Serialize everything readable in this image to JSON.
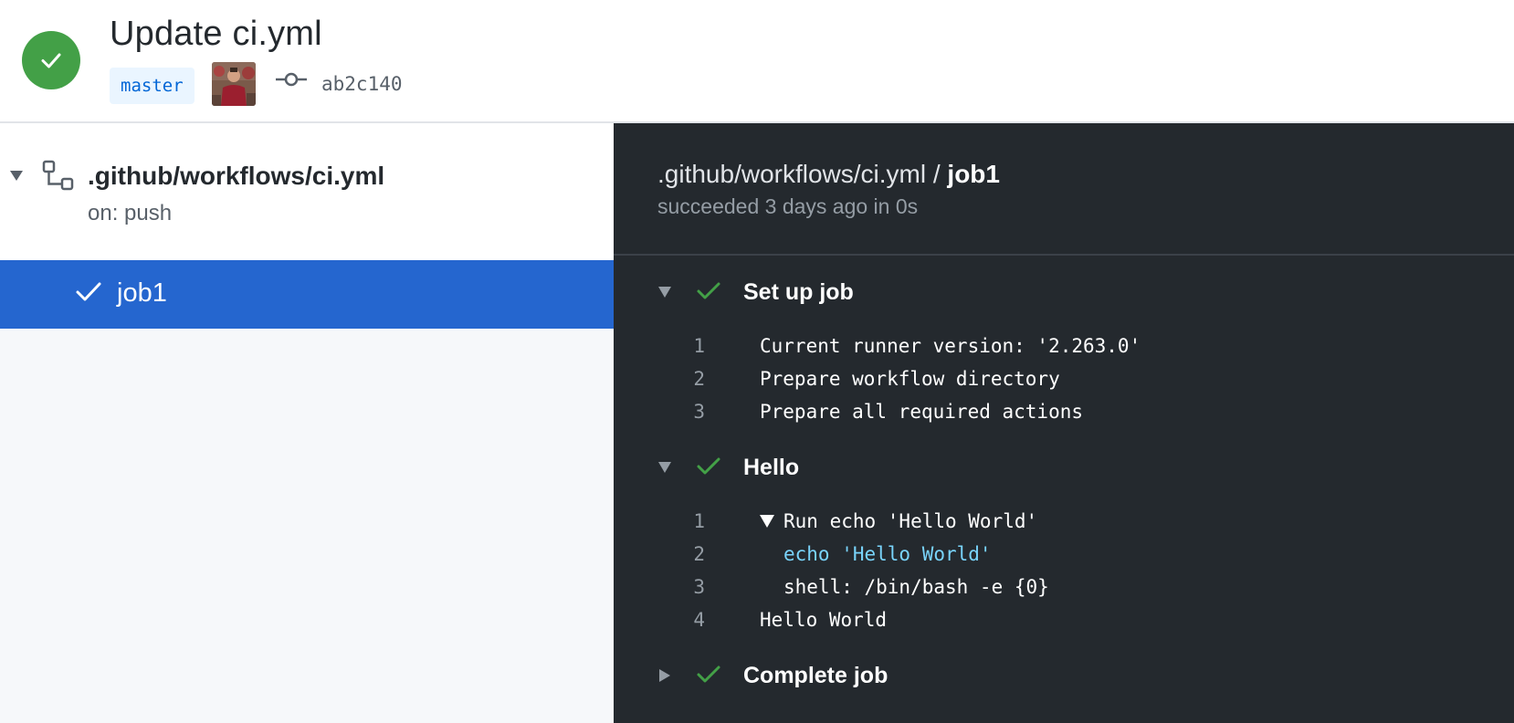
{
  "header": {
    "title": "Update ci.yml",
    "branch": "master",
    "commit_sha": "ab2c140",
    "status_color": "#43a047",
    "icons": {
      "status": "check-icon",
      "commit": "git-commit-icon"
    }
  },
  "sidebar": {
    "workflow": {
      "name": ".github/workflows/ci.yml",
      "trigger": "on: push",
      "icon": "workflow-icon"
    },
    "jobs": [
      {
        "label": "job1",
        "selected": true,
        "status": "success"
      }
    ],
    "selected_color": "#2566cf"
  },
  "log": {
    "title_path": ".github/workflows/ci.yml / ",
    "title_job": "job1",
    "subtitle": "succeeded 3 days ago in 0s",
    "steps": [
      {
        "name": "Set up job",
        "expanded": true,
        "lines": [
          {
            "num": "1",
            "text": "Current runner version: '2.263.0'"
          },
          {
            "num": "2",
            "text": "Prepare workflow directory"
          },
          {
            "num": "3",
            "text": "Prepare all required actions"
          }
        ]
      },
      {
        "name": "Hello",
        "expanded": true,
        "lines": [
          {
            "num": "1",
            "text": "Run echo 'Hello World'"
          },
          {
            "num": "2",
            "text": "echo 'Hello World'"
          },
          {
            "num": "3",
            "text": "shell: /bin/bash -e {0}"
          },
          {
            "num": "4",
            "text": "Hello World"
          }
        ]
      },
      {
        "name": "Complete job",
        "expanded": false,
        "lines": []
      }
    ],
    "colors": {
      "background": "#24292e",
      "check": "#43a047",
      "command": "#79d4fb"
    }
  }
}
